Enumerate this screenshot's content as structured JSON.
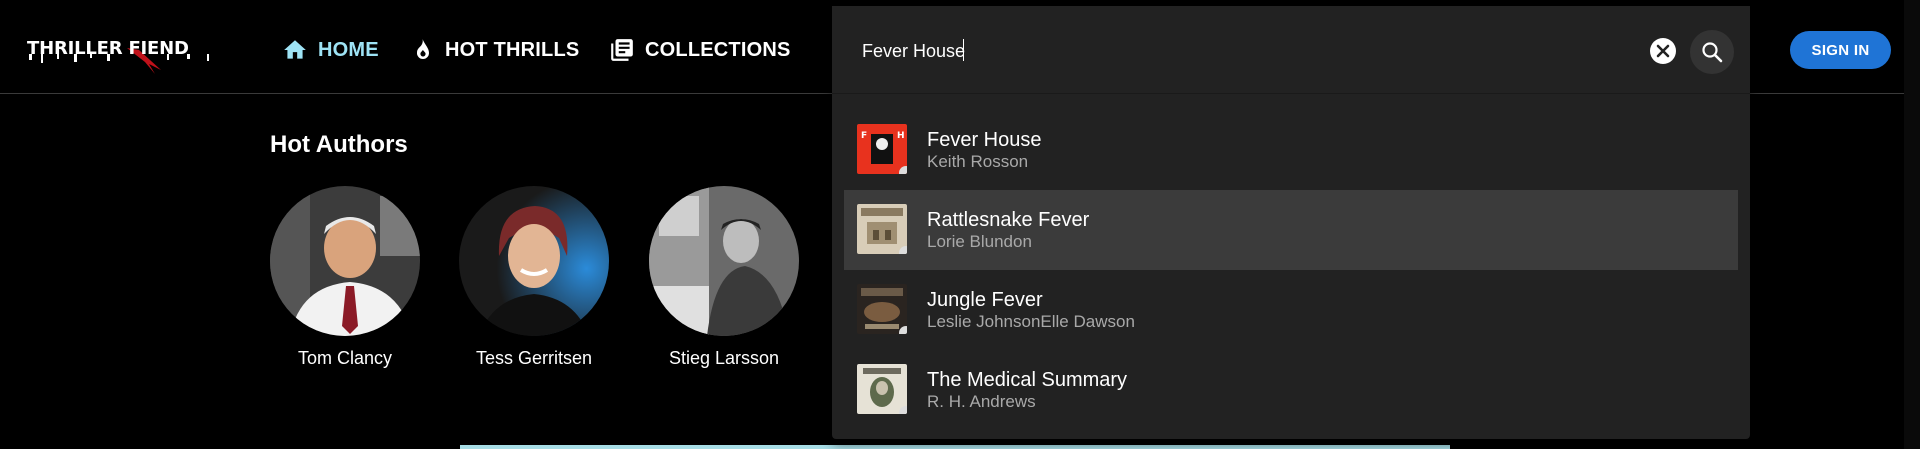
{
  "app": {
    "logo_text": "THRILLER FIEND"
  },
  "nav": {
    "home": {
      "label": "HOME",
      "icon": "home-icon"
    },
    "hot": {
      "label": "HOT THRILLS",
      "icon": "flame-icon"
    },
    "collections": {
      "label": "COLLECTIONS",
      "icon": "library-icon"
    }
  },
  "search": {
    "value": "Fever House",
    "placeholder": "",
    "clear_icon": "close-icon",
    "search_icon": "search-icon",
    "results": [
      {
        "title": "Fever House",
        "author": "Keith Rosson",
        "active": false
      },
      {
        "title": "Rattlesnake Fever",
        "author": "Lorie Blundon",
        "active": true
      },
      {
        "title": "Jungle Fever",
        "author": "Leslie JohnsonElle Dawson",
        "active": false
      },
      {
        "title": "The Medical Summary",
        "author": "R. H. Andrews",
        "active": false
      }
    ]
  },
  "auth": {
    "signin_label": "SIGN IN"
  },
  "hot_authors": {
    "title": "Hot Authors",
    "authors": [
      {
        "name": "Tom Clancy"
      },
      {
        "name": "Tess Gerritsen"
      },
      {
        "name": "Stieg Larsson"
      }
    ]
  },
  "colors": {
    "accent_home": "#9ee3f5",
    "signin": "#1f74d6",
    "panel": "#222222"
  }
}
